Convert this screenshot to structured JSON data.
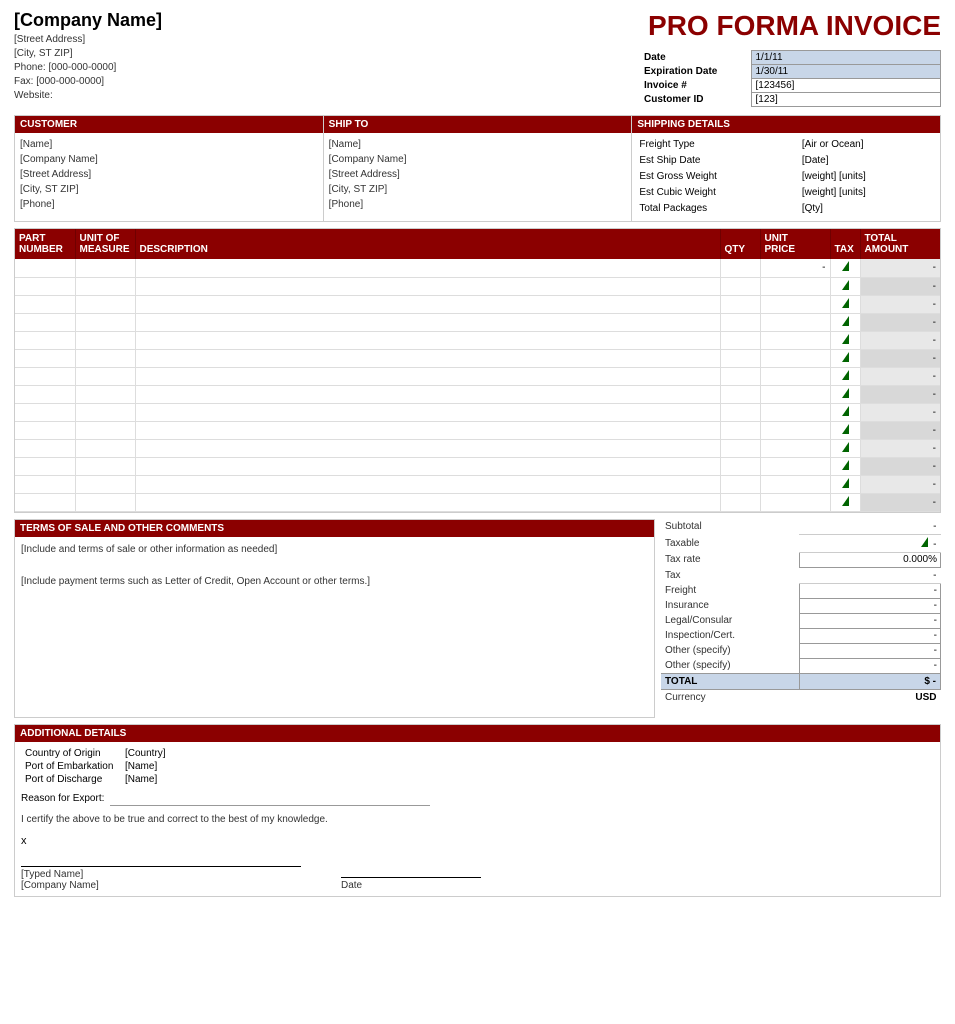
{
  "header": {
    "company_name": "[Company Name]",
    "street_address": "[Street Address]",
    "city_state_zip": "[City, ST  ZIP]",
    "phone": "Phone: [000-000-0000]",
    "fax": "Fax: [000-000-0000]",
    "website": "Website:",
    "invoice_title": "PRO FORMA INVOICE"
  },
  "invoice_meta": {
    "date_label": "Date",
    "date_value": "1/1/11",
    "expiration_label": "Expiration Date",
    "expiration_value": "1/30/11",
    "invoice_num_label": "Invoice #",
    "invoice_num_value": "[123456]",
    "customer_id_label": "Customer ID",
    "customer_id_value": "[123]"
  },
  "customer": {
    "header": "CUSTOMER",
    "name": "[Name]",
    "company": "[Company Name]",
    "address": "[Street Address]",
    "city": "[City, ST  ZIP]",
    "phone": "[Phone]"
  },
  "ship_to": {
    "header": "SHIP TO",
    "name": "[Name]",
    "company": "[Company Name]",
    "address": "[Street Address]",
    "city": "[City, ST  ZIP]",
    "phone": "[Phone]"
  },
  "shipping_details": {
    "header": "SHIPPING DETAILS",
    "freight_type_label": "Freight Type",
    "freight_type_value": "[Air or Ocean]",
    "est_ship_date_label": "Est Ship Date",
    "est_ship_date_value": "[Date]",
    "est_gross_weight_label": "Est Gross Weight",
    "est_gross_weight_value": "[weight] [units]",
    "est_cubic_weight_label": "Est Cubic Weight",
    "est_cubic_weight_value": "[weight] [units]",
    "total_packages_label": "Total Packages",
    "total_packages_value": "[Qty]"
  },
  "items_table": {
    "headers": {
      "part_number": "PART NUMBER",
      "unit_of_measure": "UNIT OF MEASURE",
      "description": "DESCRIPTION",
      "qty": "QTY",
      "unit_price": "UNIT PRICE",
      "tax": "TAX",
      "total_amount": "TOTAL AMOUNT"
    },
    "rows": [
      {
        "part": "",
        "uom": "",
        "desc": "",
        "qty": "",
        "price": "-",
        "tax": true,
        "total": "-"
      },
      {
        "part": "",
        "uom": "",
        "desc": "",
        "qty": "",
        "price": "",
        "tax": true,
        "total": "-"
      },
      {
        "part": "",
        "uom": "",
        "desc": "",
        "qty": "",
        "price": "",
        "tax": true,
        "total": "-"
      },
      {
        "part": "",
        "uom": "",
        "desc": "",
        "qty": "",
        "price": "",
        "tax": true,
        "total": "-"
      },
      {
        "part": "",
        "uom": "",
        "desc": "",
        "qty": "",
        "price": "",
        "tax": true,
        "total": "-"
      },
      {
        "part": "",
        "uom": "",
        "desc": "",
        "qty": "",
        "price": "",
        "tax": true,
        "total": "-"
      },
      {
        "part": "",
        "uom": "",
        "desc": "",
        "qty": "",
        "price": "",
        "tax": true,
        "total": "-"
      },
      {
        "part": "",
        "uom": "",
        "desc": "",
        "qty": "",
        "price": "",
        "tax": true,
        "total": "-"
      },
      {
        "part": "",
        "uom": "",
        "desc": "",
        "qty": "",
        "price": "",
        "tax": true,
        "total": "-"
      },
      {
        "part": "",
        "uom": "",
        "desc": "",
        "qty": "",
        "price": "",
        "tax": true,
        "total": "-"
      },
      {
        "part": "",
        "uom": "",
        "desc": "",
        "qty": "",
        "price": "",
        "tax": true,
        "total": "-"
      },
      {
        "part": "",
        "uom": "",
        "desc": "",
        "qty": "",
        "price": "",
        "tax": true,
        "total": "-"
      },
      {
        "part": "",
        "uom": "",
        "desc": "",
        "qty": "",
        "price": "",
        "tax": true,
        "total": "-"
      },
      {
        "part": "",
        "uom": "",
        "desc": "",
        "qty": "",
        "price": "",
        "tax": true,
        "total": "-"
      }
    ]
  },
  "terms": {
    "header": "TERMS OF SALE AND OTHER COMMENTS",
    "line1": "[Include and terms of sale or other information as needed]",
    "line2": "[Include payment terms such as Letter of Credit, Open Account or other terms.]"
  },
  "totals": {
    "subtotal_label": "Subtotal",
    "subtotal_value": "-",
    "taxable_label": "Taxable",
    "taxable_value": "-",
    "tax_rate_label": "Tax rate",
    "tax_rate_value": "0.000%",
    "tax_label": "Tax",
    "tax_value": "-",
    "freight_label": "Freight",
    "freight_value": "-",
    "insurance_label": "Insurance",
    "insurance_value": "-",
    "legal_label": "Legal/Consular",
    "legal_value": "-",
    "inspection_label": "Inspection/Cert.",
    "inspection_value": "-",
    "other1_label": "Other (specify)",
    "other1_value": "-",
    "other2_label": "Other (specify)",
    "other2_value": "-",
    "total_label": "TOTAL",
    "total_symbol": "$",
    "total_value": "-",
    "currency_label": "Currency",
    "currency_value": "USD"
  },
  "additional": {
    "header": "ADDITIONAL DETAILS",
    "country_label": "Country of Origin",
    "country_value": "[Country]",
    "port_embark_label": "Port of Embarkation",
    "port_embark_value": "[Name]",
    "port_discharge_label": "Port of Discharge",
    "port_discharge_value": "[Name]",
    "reason_label": "Reason for Export:",
    "certify_text": "I certify the above to be true and correct to the best of my knowledge.",
    "x_label": "x",
    "typed_name": "[Typed Name]",
    "company_name": "[Company Name]",
    "date_label": "Date"
  }
}
